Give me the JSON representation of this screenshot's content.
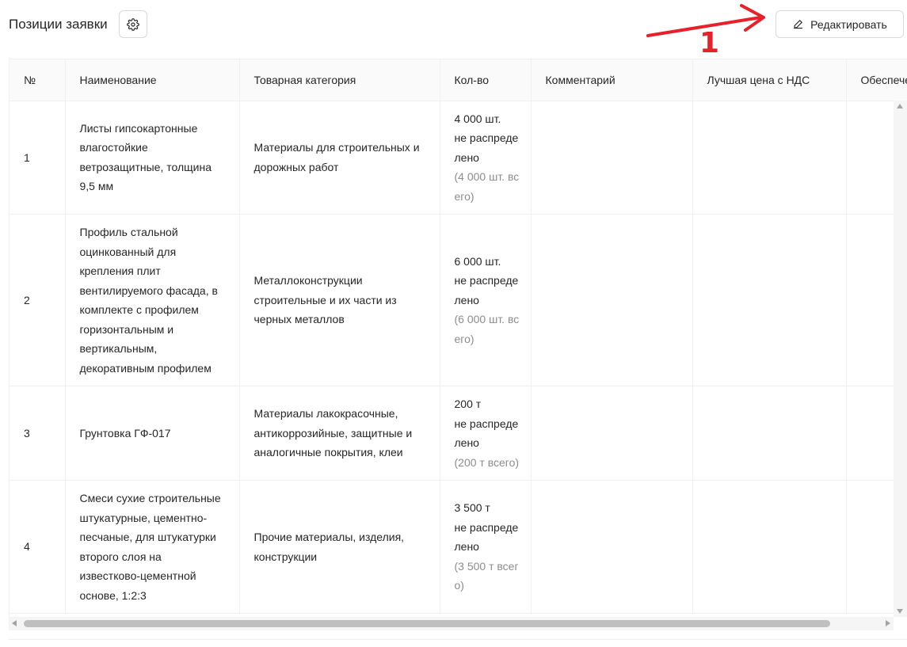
{
  "header": {
    "title": "Позиции заявки",
    "settings_icon": "gear-icon",
    "edit_icon": "pencil-icon",
    "edit_label": "Редактировать"
  },
  "annotation": {
    "number": "1",
    "color": "#e8202a"
  },
  "table": {
    "columns": [
      "№",
      "Наименование",
      "Товарная категория",
      "Кол-во",
      "Комментарий",
      "Лучшая цена с НДС",
      "Обеспечение"
    ],
    "rows": [
      {
        "num": "1",
        "name": "Листы гипсокартонные влагостойкие ветрозащитные, толщина 9,5 мм",
        "category": "Материалы для строительных и дорожных работ",
        "qty": "4 000 шт.",
        "qty_status": "не распределено",
        "qty_total": "(4 000 шт. всего)",
        "comment": "",
        "best_price": "",
        "provision": ""
      },
      {
        "num": "2",
        "name": "Профиль стальной оцинкованный для крепления плит вентилируемого фасада, в комплекте с профилем горизонтальным и вертикальным, декоративным профилем",
        "category": "Металлоконструкции строительные и их части из черных металлов",
        "qty": "6 000 шт.",
        "qty_status": "не распределено",
        "qty_total": "(6 000 шт. всего)",
        "comment": "",
        "best_price": "",
        "provision": ""
      },
      {
        "num": "3",
        "name": "Грунтовка ГФ-017",
        "category": "Материалы лакокрасочные, антикоррозийные, защитные и аналогичные покрытия, клеи",
        "qty": "200 т",
        "qty_status": "не распределено",
        "qty_total": "(200 т всего)",
        "comment": "",
        "best_price": "",
        "provision": ""
      },
      {
        "num": "4",
        "name": "Смеси сухие строительные штукатурные, цементно-песчаные, для штукатурки второго слоя на известково-цементной основе, 1:2:3",
        "category": "Прочие материалы, изделия, конструкции",
        "qty": "3 500 т",
        "qty_status": "не распределено",
        "qty_total": "(3 500 т всего)",
        "comment": "",
        "best_price": "",
        "provision": ""
      }
    ]
  }
}
